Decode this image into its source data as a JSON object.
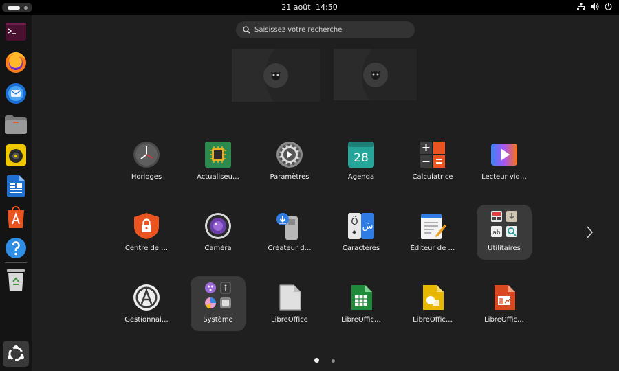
{
  "topbar": {
    "date": "21 août",
    "time": "14:50",
    "tray_icons": [
      "network-icon",
      "volume-icon",
      "power-icon"
    ]
  },
  "dock": {
    "items": [
      {
        "name": "terminal",
        "icon": "terminal-icon"
      },
      {
        "name": "firefox",
        "icon": "firefox-icon"
      },
      {
        "name": "thunderbird",
        "icon": "thunderbird-icon"
      },
      {
        "name": "files",
        "icon": "folder-icon"
      },
      {
        "name": "rhythmbox",
        "icon": "speaker-icon"
      },
      {
        "name": "writer",
        "icon": "document-icon"
      },
      {
        "name": "app-center",
        "icon": "store-icon"
      },
      {
        "name": "help",
        "icon": "help-icon"
      },
      {
        "name": "trash",
        "icon": "trash-icon"
      },
      {
        "name": "show-apps",
        "icon": "ubuntu-icon"
      }
    ]
  },
  "search": {
    "placeholder": "Saisissez votre recherche"
  },
  "apps": [
    {
      "label": "Horloges",
      "icon": "clock-icon"
    },
    {
      "label": "Actualiseu…",
      "icon": "chip-icon"
    },
    {
      "label": "Paramètres",
      "icon": "settings-gear-icon"
    },
    {
      "label": "Agenda",
      "icon": "calendar-icon",
      "text": "28"
    },
    {
      "label": "Calculatrice",
      "icon": "calculator-icon"
    },
    {
      "label": "Lecteur vid…",
      "icon": "video-player-icon"
    },
    {
      "label": "Centre de …",
      "icon": "lock-shield-icon"
    },
    {
      "label": "Caméra",
      "icon": "camera-icon"
    },
    {
      "label": "Créateur d…",
      "icon": "usb-creator-icon"
    },
    {
      "label": "Caractères",
      "icon": "characters-icon",
      "text_a": "Ö",
      "text_b": "ش"
    },
    {
      "label": "Éditeur de …",
      "icon": "text-editor-icon"
    },
    {
      "label": "Utilitaires",
      "icon": "folder-utilities-icon"
    },
    {
      "label": "Gestionnai…",
      "icon": "software-manager-icon"
    },
    {
      "label": "Système",
      "icon": "folder-system-icon"
    },
    {
      "label": "LibreOffice",
      "icon": "libreoffice-icon"
    },
    {
      "label": "LibreOffic…",
      "icon": "libreoffice-calc-icon"
    },
    {
      "label": "LibreOffic…",
      "icon": "libreoffice-draw-icon"
    },
    {
      "label": "LibreOffic…",
      "icon": "libreoffice-impress-icon"
    }
  ],
  "pagination": {
    "pages": 2,
    "current": 1
  },
  "colors": {
    "background": "#1f1f1f",
    "topbar": "#000000",
    "dock": "#141414",
    "folder": "#3a3a3a",
    "accent_orange": "#e95420"
  }
}
